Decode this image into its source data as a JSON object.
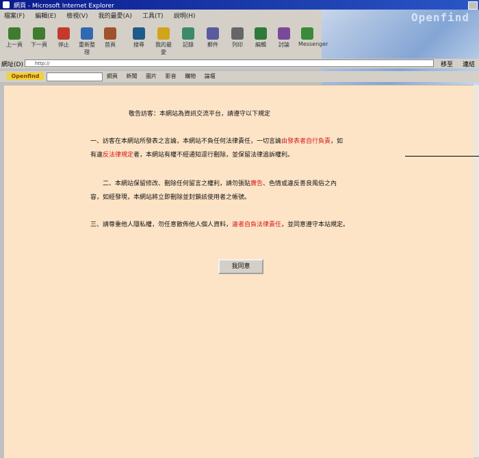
{
  "window": {
    "title": "網頁 - Microsoft Internet Explorer"
  },
  "menu": [
    "檔案(F)",
    "編輯(E)",
    "檢視(V)",
    "我的最愛(A)",
    "工具(T)",
    "說明(H)"
  ],
  "brand": {
    "text": "Openfind"
  },
  "toolbar": [
    {
      "label": "上一頁",
      "icon": "back-arrow-icon"
    },
    {
      "label": "下一頁",
      "icon": "forward-arrow-icon"
    },
    {
      "label": "停止",
      "icon": "stop-icon"
    },
    {
      "label": "重新整理",
      "icon": "refresh-icon"
    },
    {
      "label": "首頁",
      "icon": "home-icon"
    },
    {
      "label": "搜尋",
      "icon": "search-icon"
    },
    {
      "label": "我的最愛",
      "icon": "favorites-icon"
    },
    {
      "label": "記錄",
      "icon": "history-icon"
    },
    {
      "label": "郵件",
      "icon": "mail-icon"
    },
    {
      "label": "列印",
      "icon": "print-icon"
    },
    {
      "label": "編輯",
      "icon": "edit-icon"
    },
    {
      "label": "討論",
      "icon": "discuss-icon"
    },
    {
      "label": "Messenger",
      "icon": "messenger-icon"
    }
  ],
  "address": {
    "label": "網址(D)",
    "url": "http://",
    "go": "移至",
    "links": "連結"
  },
  "linksbar": {
    "logo": "Openfind",
    "items": [
      "網頁",
      "新聞",
      "圖片",
      "影音",
      "購物",
      "論壇"
    ]
  },
  "colors": {
    "content_bg": "#fde4c7",
    "accent_red": "#d31a1a"
  },
  "content": {
    "heading": "敬告訪客：本網站為資訊交流平台，請遵守以下規定",
    "para1_line1_a": "一、訪客在本網站所發表之言論，本網站不負任何法律責任，一切言論",
    "para1_line1_red": "由發表者自行負責",
    "para1_line1_b": "，如",
    "para1_line2_a": "有違",
    "para1_line2_red": "反法律規定",
    "para1_line2_b": "者，本網站有權不經通知逕行刪除，並保留法律追訴權利。",
    "para2_line1_a": "二、本網站保留修改、刪除任何留言之權利，請勿張貼",
    "para2_line1_red": "廣告",
    "para2_line1_b": "、色情或違反善良風俗之內",
    "para2_line2": "容，如經發現，本網站將立即刪除並封鎖該使用者之帳號。",
    "para3_a": "三、請尊重他人隱私權，勿任意散佈他人個人資料，",
    "para3_red": "違者自負法律責任",
    "para3_b": "，並同意遵守本站規定。",
    "button": "我同意"
  }
}
